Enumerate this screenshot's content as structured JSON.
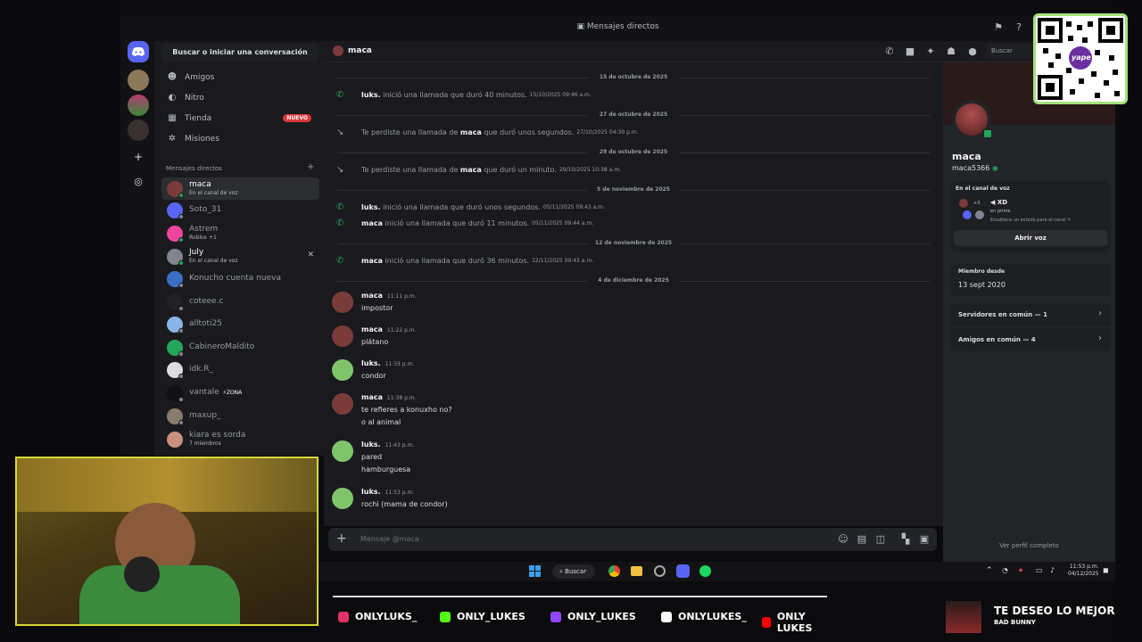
{
  "window": {
    "title": "Mensajes directos"
  },
  "dm_sidebar": {
    "search": "Buscar o iniciar una conversación",
    "nav": [
      {
        "label": "Amigos",
        "icon": "friends-icon"
      },
      {
        "label": "Nitro",
        "icon": "nitro-icon"
      },
      {
        "label": "Tienda",
        "icon": "shop-icon",
        "badge": "NUEVO"
      },
      {
        "label": "Misiones",
        "icon": "quests-icon"
      }
    ],
    "dm_header": "Mensajes directos",
    "dms": [
      {
        "name": "maca",
        "sub": "En el canal de voz",
        "color": "#7a3b3b",
        "status": "#23a55a"
      },
      {
        "name": "Soto_31",
        "sub": "",
        "color": "#5865f2",
        "status": "#80848e"
      },
      {
        "name": "Astrem",
        "sub": "Roblox +1",
        "color": "#eb459e",
        "status": "#23a55a"
      },
      {
        "name": "July",
        "sub": "En el canal de voz",
        "color": "#80848e",
        "status": "#23a55a"
      },
      {
        "name": "Konucho cuenta nueva",
        "sub": "",
        "color": "#3b6fc4",
        "status": "#80848e"
      },
      {
        "name": "coteee.c",
        "sub": "",
        "color": "#222",
        "status": "#80848e"
      },
      {
        "name": "alltoti25",
        "sub": "",
        "color": "#8ab4e8",
        "status": "#80848e"
      },
      {
        "name": "CabineroMaldito",
        "sub": "",
        "color": "#23a55a",
        "status": "#80848e"
      },
      {
        "name": "idk.R_",
        "sub": "",
        "color": "#ddd",
        "status": "#80848e"
      },
      {
        "name": "vantale",
        "sub": "",
        "tag": "⚡ZONA",
        "color": "#111",
        "status": "#80848e"
      },
      {
        "name": "maxup_",
        "sub": "",
        "color": "#8a7a6a",
        "status": "#80848e"
      },
      {
        "name": "kiara es sorda",
        "sub": "7 miembros",
        "color": "#c98f7f",
        "status": ""
      }
    ]
  },
  "chat": {
    "channel": "maca",
    "search": "Buscar",
    "placeholder": "Mensaje @maca",
    "dates": [
      "15 de octubre de 2025",
      "27 de octubre de 2025",
      "29 de octubre de 2025",
      "5 de noviembre de 2025",
      "12 de noviembre de 2025",
      "4 de diciembre de 2025"
    ],
    "system": [
      {
        "who": "luks.",
        "text": "inició una llamada que duró 40 minutos.",
        "ts": "15/10/2025 09:46 a.m.",
        "missed": false
      },
      {
        "pre": "Te perdiste una llamada de",
        "who": "maca",
        "text": "que duró unos segundos.",
        "ts": "27/10/2025 04:30 p.m.",
        "missed": true
      },
      {
        "pre": "Te perdiste una llamada de",
        "who": "maca",
        "text": "que duró un minuto.",
        "ts": "29/10/2025 10:38 a.m.",
        "missed": true
      },
      {
        "who": "luks.",
        "text": "inició una llamada que duró unos segundos.",
        "ts": "05/11/2025 09:43 a.m.",
        "missed": false
      },
      {
        "who": "maca",
        "text": "inició una llamada que duró 11 minutos.",
        "ts": "05/11/2025 09:44 a.m.",
        "missed": false
      },
      {
        "who": "maca",
        "text": "inició una llamada que duró 36 minutos.",
        "ts": "12/11/2025 09:43 a.m.",
        "missed": false
      }
    ],
    "messages": [
      {
        "author": "maca",
        "time": "11:11 p.m.",
        "lines": [
          "impostor"
        ],
        "color": "#7a3b3b"
      },
      {
        "author": "maca",
        "time": "11:22 p.m.",
        "lines": [
          "plátano"
        ],
        "color": "#7a3b3b"
      },
      {
        "author": "luks.",
        "time": "11:33 p.m.",
        "lines": [
          "condor"
        ],
        "color": "#7fc46a"
      },
      {
        "author": "maca",
        "time": "11:38 p.m.",
        "lines": [
          "te refieres a konuxho no?",
          "o al animal"
        ],
        "color": "#7a3b3b"
      },
      {
        "author": "luks.",
        "time": "11:43 p.m.",
        "lines": [
          "pared",
          "hamburguesa"
        ],
        "color": "#7fc46a"
      },
      {
        "author": "luks.",
        "time": "11:53 p.m.",
        "lines": [
          "rochi (mama de condor)"
        ],
        "color": "#7fc46a"
      }
    ]
  },
  "profile": {
    "name": "maca",
    "handle": "maca5366",
    "voice_header": "En el canal de voz",
    "voice_count": "+3",
    "voice_channel": "XD",
    "voice_server": "en prime",
    "voice_hint": "Establece un estado para el canal",
    "open_voice": "Abrir voz",
    "member_since_label": "Miembro desde",
    "member_since": "13 sept 2020",
    "servers_common": "Servidores en común — 1",
    "friends_common": "Amigos en común — 4",
    "full_profile": "Ver perfil completo"
  },
  "taskbar": {
    "search": "Buscar",
    "time": "11:53 p.m.",
    "date": "04/12/2025"
  },
  "overlay": {
    "socials": [
      {
        "label": "ONLYLUKS_",
        "color": "#e1306c"
      },
      {
        "label": "ONLY_LUKES",
        "color": "#53fc18"
      },
      {
        "label": "ONLY_LUKES",
        "color": "#9146ff"
      },
      {
        "label": "ONLYLUKES_",
        "color": "#ffffff"
      },
      {
        "label": "ONLY LUKES",
        "color": "#ff0000"
      }
    ],
    "song_title": "TE DESEO LO MEJOR",
    "song_artist": "BAD BUNNY",
    "qr_label": "yape"
  }
}
